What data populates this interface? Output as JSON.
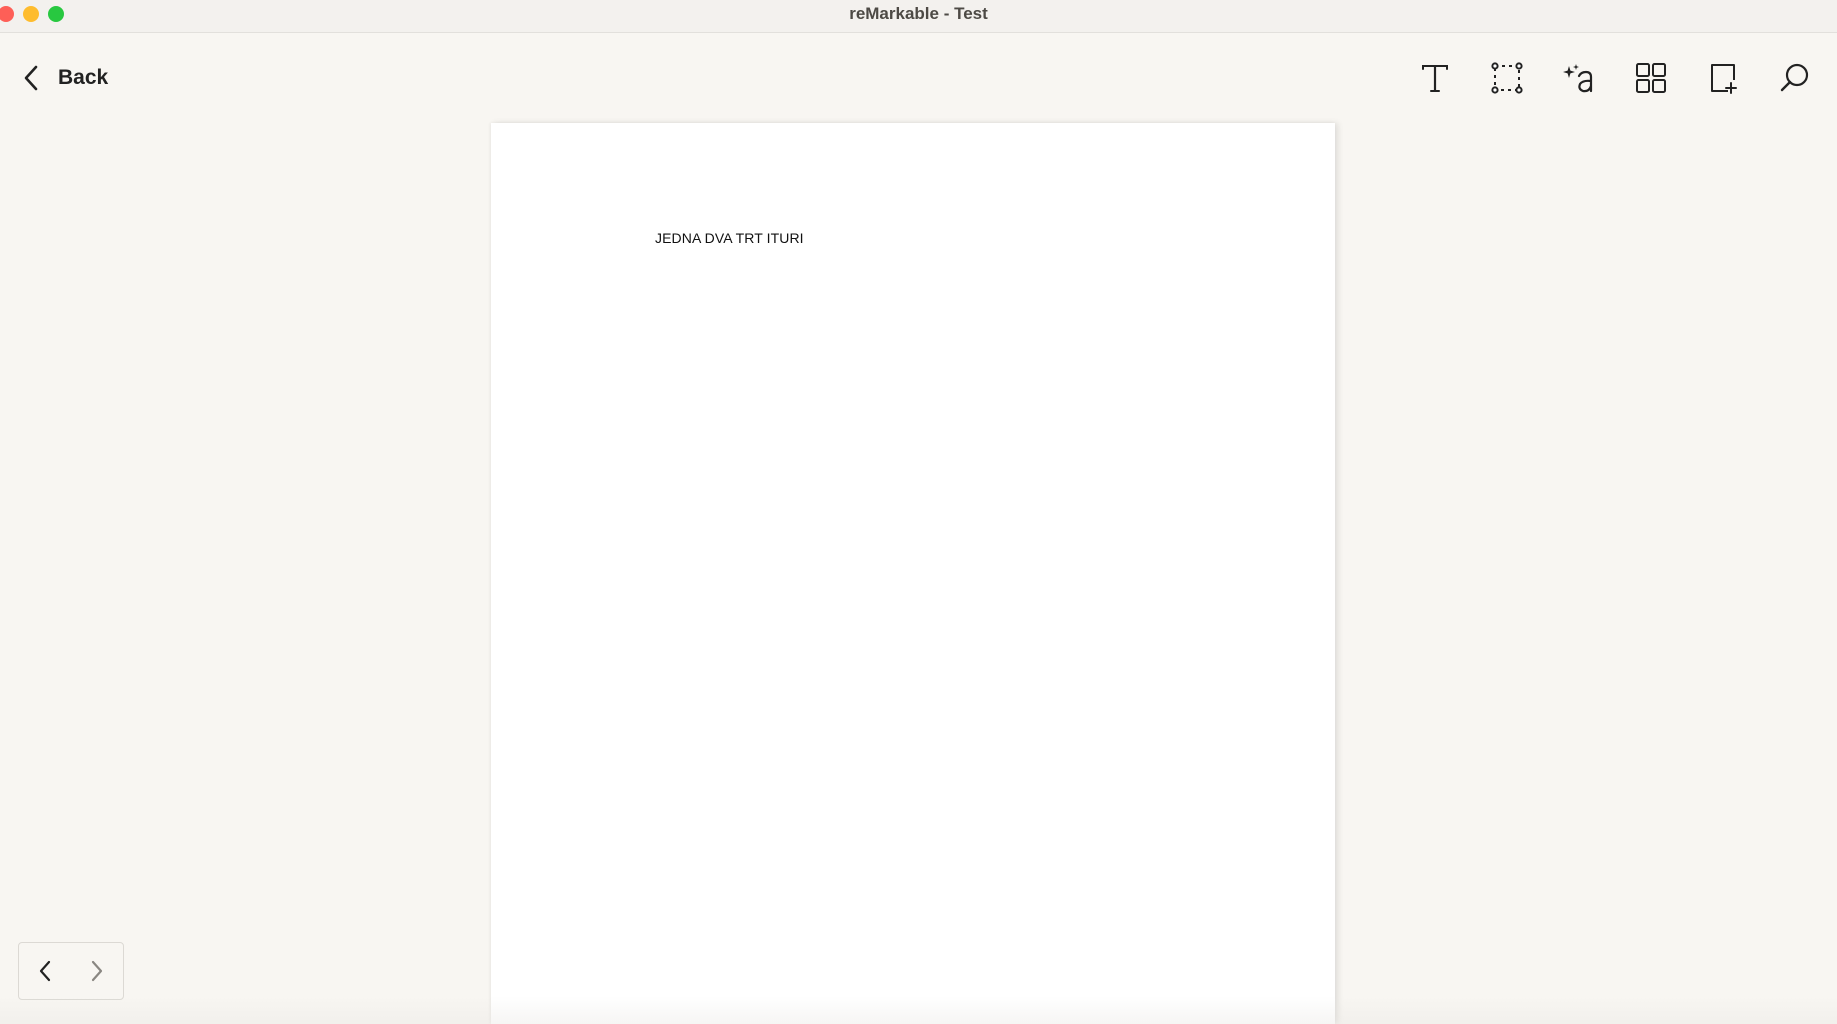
{
  "window": {
    "title": "reMarkable - Test"
  },
  "header": {
    "back_label": "Back"
  },
  "toolbar": {
    "items": [
      {
        "name": "text-tool",
        "icon": "text-icon"
      },
      {
        "name": "selection-tool",
        "icon": "selection-icon"
      },
      {
        "name": "convert-text-tool",
        "icon": "sparkle-a-icon"
      },
      {
        "name": "page-overview-tool",
        "icon": "grid-icon"
      },
      {
        "name": "add-page-tool",
        "icon": "add-page-icon"
      },
      {
        "name": "search-tool",
        "icon": "search-icon"
      }
    ]
  },
  "page": {
    "content_text": "JEDNA DVA TRT ITURI"
  },
  "pager": {
    "prev_icon": "chevron-left-icon",
    "next_icon": "chevron-right-icon"
  },
  "colors": {
    "background": "#f8f6f2",
    "page": "#ffffff",
    "traffic_red": "#fe5f57",
    "traffic_yellow": "#febc2e",
    "traffic_green": "#28c840"
  }
}
